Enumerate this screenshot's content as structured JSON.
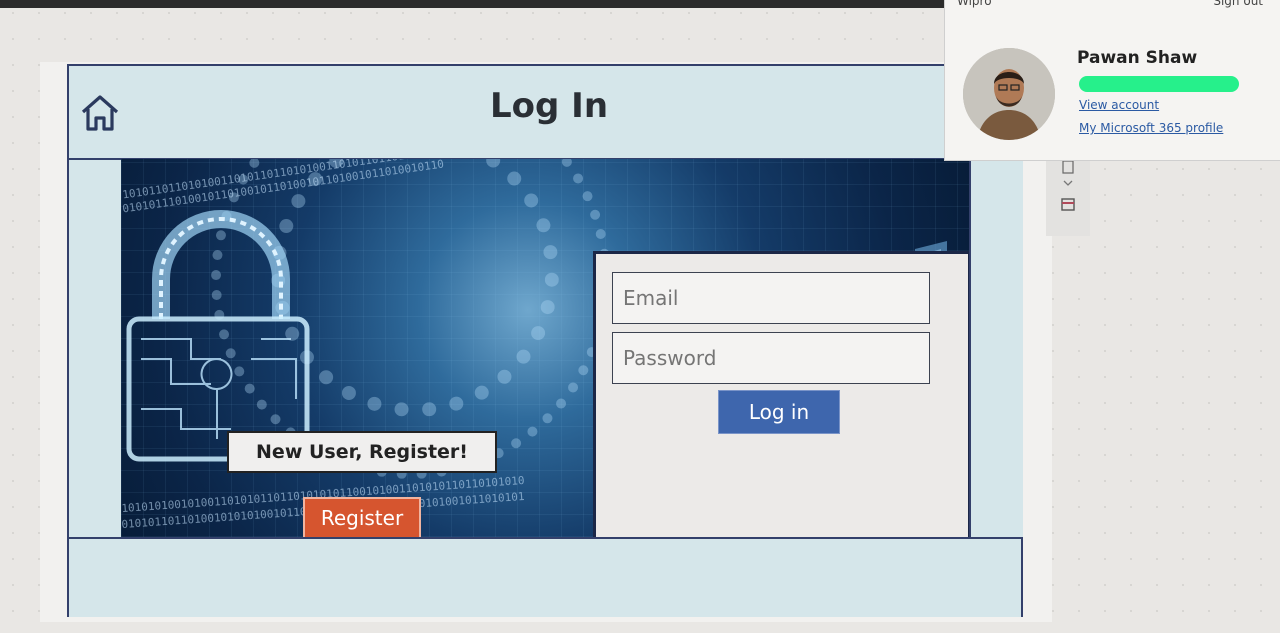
{
  "app": {
    "title": "Log In",
    "register_prompt": "New User, Register!",
    "register_button": "Register",
    "email_placeholder": "Email",
    "password_placeholder": "Password",
    "login_button": "Log in"
  },
  "account_panel": {
    "org_name": "Wipro",
    "sign_out": "Sign out",
    "user_name": "Pawan Shaw",
    "view_account": "View account",
    "ms_profile": "My Microsoft 365 profile"
  },
  "colors": {
    "panel_bg": "#d5e6ea",
    "border": "#33406b",
    "register": "#d6552f",
    "login": "#3e66ad",
    "email_redaction": "#26f08b"
  },
  "icons": [
    "home-icon",
    "lock-circuit-image",
    "document-icon",
    "chevron-down-icon",
    "calendar-icon"
  ]
}
